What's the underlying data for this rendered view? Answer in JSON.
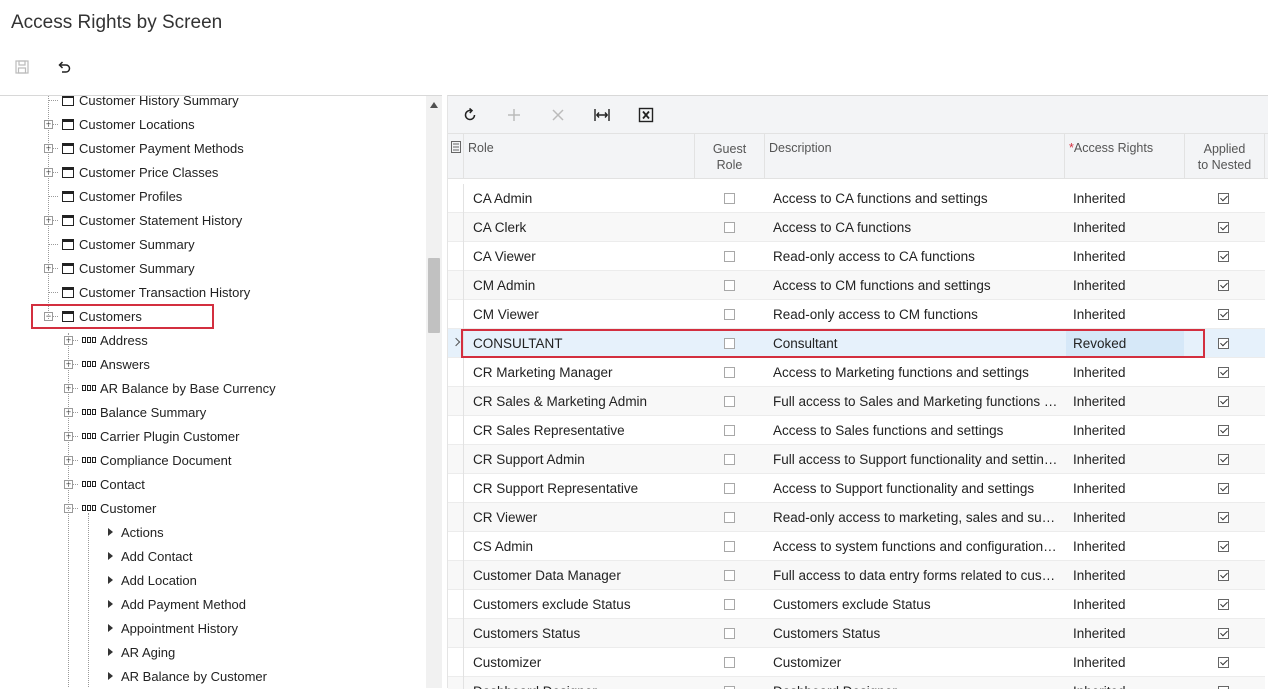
{
  "page": {
    "title": "Access Rights by Screen"
  },
  "toolbar": {
    "save_icon": "save-icon",
    "undo_icon": "undo-icon"
  },
  "tree": {
    "items": [
      {
        "label": "Customer History Summary",
        "level": 0,
        "type": "screen",
        "expander": ""
      },
      {
        "label": "Customer Locations",
        "level": 0,
        "type": "screen",
        "expander": "+"
      },
      {
        "label": "Customer Payment Methods",
        "level": 0,
        "type": "screen",
        "expander": "+"
      },
      {
        "label": "Customer Price Classes",
        "level": 0,
        "type": "screen",
        "expander": "+"
      },
      {
        "label": "Customer Profiles",
        "level": 0,
        "type": "screen",
        "expander": ""
      },
      {
        "label": "Customer Statement History",
        "level": 0,
        "type": "screen",
        "expander": "+"
      },
      {
        "label": "Customer Summary",
        "level": 0,
        "type": "screen",
        "expander": ""
      },
      {
        "label": "Customer Summary",
        "level": 0,
        "type": "screen",
        "expander": "+"
      },
      {
        "label": "Customer Transaction History",
        "level": 0,
        "type": "screen",
        "expander": ""
      },
      {
        "label": "Customers",
        "level": 0,
        "type": "screen",
        "expander": "−"
      },
      {
        "label": "Address",
        "level": 1,
        "type": "container",
        "expander": "+"
      },
      {
        "label": "Answers",
        "level": 1,
        "type": "container",
        "expander": "+"
      },
      {
        "label": "AR Balance by Base Currency",
        "level": 1,
        "type": "container",
        "expander": "+"
      },
      {
        "label": "Balance Summary",
        "level": 1,
        "type": "container",
        "expander": "+"
      },
      {
        "label": "Carrier Plugin Customer",
        "level": 1,
        "type": "container",
        "expander": "+"
      },
      {
        "label": "Compliance Document",
        "level": 1,
        "type": "container",
        "expander": "+"
      },
      {
        "label": "Contact",
        "level": 1,
        "type": "container",
        "expander": "+"
      },
      {
        "label": "Customer",
        "level": 1,
        "type": "container",
        "expander": "−"
      },
      {
        "label": "Actions",
        "level": 2,
        "type": "action",
        "expander": ""
      },
      {
        "label": "Add Contact",
        "level": 2,
        "type": "action",
        "expander": ""
      },
      {
        "label": "Add Location",
        "level": 2,
        "type": "action",
        "expander": ""
      },
      {
        "label": "Add Payment Method",
        "level": 2,
        "type": "action",
        "expander": ""
      },
      {
        "label": "Appointment History",
        "level": 2,
        "type": "action",
        "expander": ""
      },
      {
        "label": "AR Aging",
        "level": 2,
        "type": "action",
        "expander": ""
      },
      {
        "label": "AR Balance by Customer",
        "level": 2,
        "type": "action",
        "expander": ""
      }
    ]
  },
  "grid": {
    "toolbar": [
      "refresh-icon",
      "add-icon",
      "delete-icon",
      "fit-columns-icon",
      "export-excel-icon"
    ],
    "headers": {
      "role": "Role",
      "guest_role_1": "Guest",
      "guest_role_2": "Role",
      "description": "Description",
      "required_mark": "*",
      "access_rights": "Access Rights",
      "applied_1": "Applied",
      "applied_2": "to Nested"
    },
    "rows": [
      {
        "role": "CA Admin",
        "guest": false,
        "description": "Access to CA functions and settings",
        "access": "Inherited",
        "applied": true
      },
      {
        "role": "CA Clerk",
        "guest": false,
        "description": "Access to CA functions",
        "access": "Inherited",
        "applied": true
      },
      {
        "role": "CA Viewer",
        "guest": false,
        "description": "Read-only access to CA functions",
        "access": "Inherited",
        "applied": true
      },
      {
        "role": "CM Admin",
        "guest": false,
        "description": "Access to CM functions and settings",
        "access": "Inherited",
        "applied": true
      },
      {
        "role": "CM Viewer",
        "guest": false,
        "description": "Read-only access to CM functions",
        "access": "Inherited",
        "applied": true
      },
      {
        "role": "CONSULTANT",
        "guest": false,
        "description": "Consultant",
        "access": "Revoked",
        "applied": true
      },
      {
        "role": "CR Marketing Manager",
        "guest": false,
        "description": "Access to Marketing functions and settings",
        "access": "Inherited",
        "applied": true
      },
      {
        "role": "CR Sales & Marketing Admin",
        "guest": false,
        "description": "Full access to Sales and Marketing functions a...",
        "access": "Inherited",
        "applied": true
      },
      {
        "role": "CR Sales Representative",
        "guest": false,
        "description": "Access to Sales functions and settings",
        "access": "Inherited",
        "applied": true
      },
      {
        "role": "CR Support Admin",
        "guest": false,
        "description": "Full access to Support functionality and settings",
        "access": "Inherited",
        "applied": true
      },
      {
        "role": "CR Support Representative",
        "guest": false,
        "description": "Access to Support functionality and settings",
        "access": "Inherited",
        "applied": true
      },
      {
        "role": "CR Viewer",
        "guest": false,
        "description": "Read-only access to marketing, sales and sup...",
        "access": "Inherited",
        "applied": true
      },
      {
        "role": "CS Admin",
        "guest": false,
        "description": "Access to system functions and configuration i...",
        "access": "Inherited",
        "applied": true
      },
      {
        "role": "Customer Data Manager",
        "guest": false,
        "description": "Full access to data entry forms related to custo...",
        "access": "Inherited",
        "applied": true
      },
      {
        "role": "Customers exclude Status",
        "guest": false,
        "description": "Customers exclude Status",
        "access": "Inherited",
        "applied": true
      },
      {
        "role": "Customers Status",
        "guest": false,
        "description": "Customers Status",
        "access": "Inherited",
        "applied": true
      },
      {
        "role": "Customizer",
        "guest": false,
        "description": "Customizer",
        "access": "Inherited",
        "applied": true
      },
      {
        "role": "Dashboard Designer",
        "guest": false,
        "description": "Dashboard Designer",
        "access": "Inherited",
        "applied": true
      }
    ]
  },
  "colors": {
    "highlight": "#d32f3f",
    "active_row": "#e6f1fb",
    "header_bg": "#f3f4f6"
  }
}
